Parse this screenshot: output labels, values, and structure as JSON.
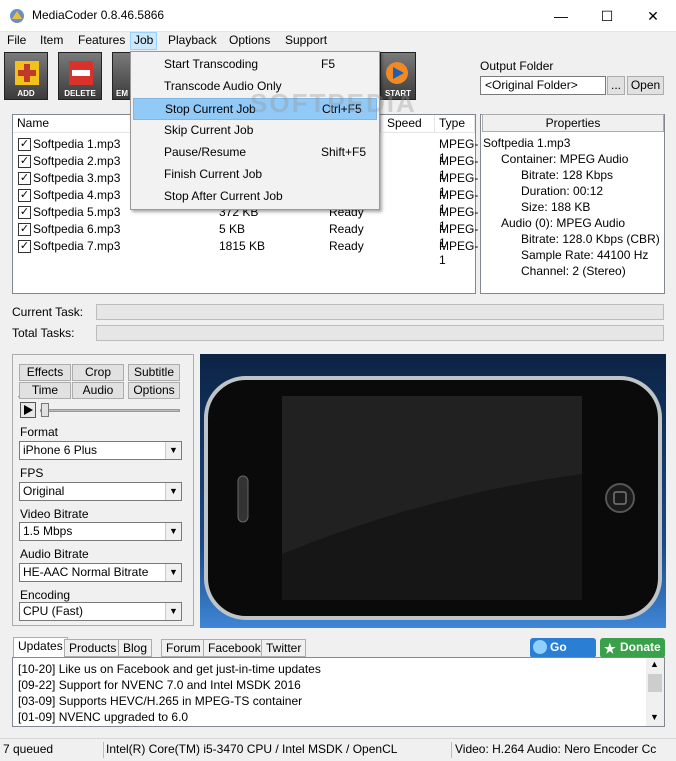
{
  "window": {
    "title": "MediaCoder 0.8.46.5866",
    "controls": {
      "minimize": "—",
      "maximize": "☐",
      "close": "✕"
    }
  },
  "menubar": {
    "items": [
      "File",
      "Item",
      "Features",
      "Job",
      "Playback",
      "Options",
      "Support"
    ],
    "active": "Job"
  },
  "toolbar": {
    "buttons": [
      {
        "label": "ADD",
        "icon": "add-icon"
      },
      {
        "label": "DELETE",
        "icon": "delete-icon"
      },
      {
        "label": "EM",
        "icon": "empty-icon"
      },
      {
        "label": "START",
        "icon": "start-icon"
      }
    ]
  },
  "output": {
    "label": "Output Folder",
    "value": "<Original Folder>",
    "browse_label": "...",
    "open_label": "Open"
  },
  "file_list": {
    "columns": {
      "name": "Name",
      "speed": "Speed",
      "type": "Type"
    },
    "rows": [
      {
        "name": "Softpedia 1.mp3",
        "size": "",
        "state": "",
        "type": "MPEG-1"
      },
      {
        "name": "Softpedia 2.mp3",
        "size": "",
        "state": "",
        "type": "MPEG-1"
      },
      {
        "name": "Softpedia 3.mp3",
        "size": "",
        "state": "",
        "type": "MPEG-1"
      },
      {
        "name": "Softpedia 4.mp3",
        "size": "",
        "state": "",
        "type": "MPEG-1"
      },
      {
        "name": "Softpedia 5.mp3",
        "size": "372 KB",
        "state": "Ready",
        "type": "MPEG-1"
      },
      {
        "name": "Softpedia 6.mp3",
        "size": "5 KB",
        "state": "Ready",
        "type": "MPEG-1"
      },
      {
        "name": "Softpedia 7.mp3",
        "size": "1815 KB",
        "state": "Ready",
        "type": "MPEG-1"
      }
    ]
  },
  "properties": {
    "header": "Properties",
    "file": "Softpedia 1.mp3",
    "container": "Container: MPEG Audio",
    "bitrate": "Bitrate: 128 Kbps",
    "duration": "Duration: 00:12",
    "size": "Size: 188 KB",
    "audio": "Audio (0): MPEG Audio",
    "audio_bitrate": "Bitrate: 128.0 Kbps (CBR)",
    "sample_rate": "Sample Rate: 44100 Hz",
    "channel": "Channel: 2 (Stereo)"
  },
  "progress": {
    "current_task_label": "Current Task:",
    "total_tasks_label": "Total Tasks:",
    "current_fraction": 0,
    "total_fraction": 0
  },
  "settings": {
    "tabs": [
      "Effects",
      "Crop",
      "Subtitle",
      "Time",
      "Audio",
      "Options"
    ],
    "format_label": "Format",
    "format_value": "iPhone 6 Plus",
    "fps_label": "FPS",
    "fps_value": "Original",
    "video_bitrate_label": "Video Bitrate",
    "video_bitrate_value": "1.5 Mbps",
    "audio_bitrate_label": "Audio Bitrate",
    "audio_bitrate_value": "HE-AAC Normal Bitrate",
    "encoding_label": "Encoding",
    "encoding_value": "CPU (Fast)"
  },
  "preview": {
    "watermark": "SOFTPEDIA"
  },
  "updates": {
    "tabs": [
      "Updates",
      "Products",
      "Blog",
      "Forum",
      "Facebook",
      "Twitter"
    ],
    "go_pro": "Go PRO",
    "donate": "Donate",
    "lines": [
      "[10-20] Like us on Facebook and get just-in-time updates",
      "[09-22] Support for NVENC 7.0 and Intel MSDK 2016",
      "[03-09] Supports HEVC/H.265 in MPEG-TS container",
      "[01-09] NVENC upgraded to 6.0"
    ]
  },
  "statusbar": {
    "queued": "7 queued",
    "cpu": "Intel(R) Core(TM) i5-3470 CPU  / Intel MSDK / OpenCL",
    "codec": "Video: H.264  Audio: Nero Encoder  Cc"
  },
  "job_menu": {
    "items": [
      {
        "label": "Start Transcoding",
        "shortcut": "F5"
      },
      {
        "label": "Transcode Audio Only",
        "shortcut": ""
      },
      {
        "label": "Stop Current Job",
        "shortcut": "Ctrl+F5"
      },
      {
        "label": "Skip Current Job",
        "shortcut": ""
      },
      {
        "label": "Pause/Resume",
        "shortcut": "Shift+F5"
      },
      {
        "label": "Finish Current Job",
        "shortcut": ""
      },
      {
        "label": "Stop After Current Job",
        "shortcut": ""
      }
    ],
    "highlighted_index": 2
  },
  "colors": {
    "menu_highlight": "#91c9f7",
    "go_pro": "#2a7fd4",
    "donate": "#3aa14a"
  }
}
